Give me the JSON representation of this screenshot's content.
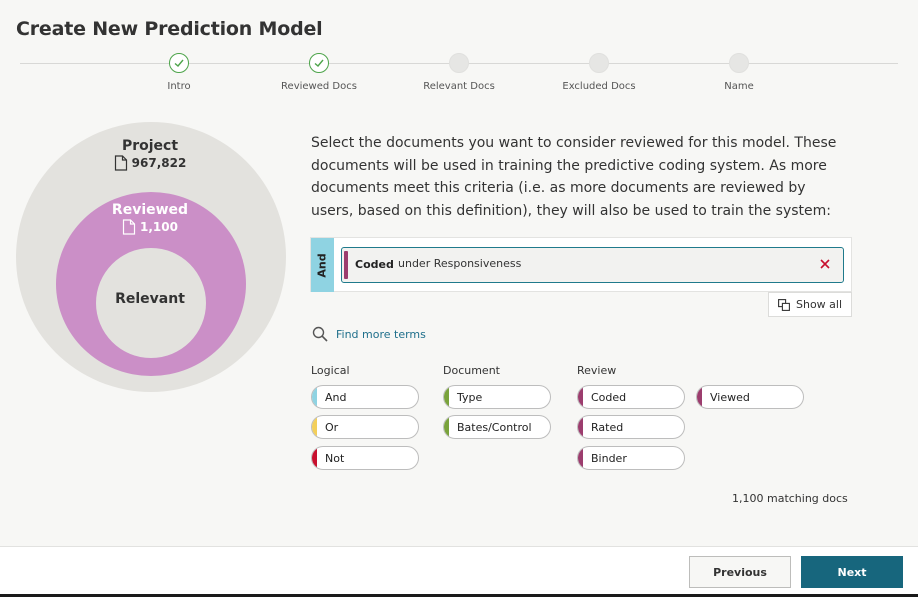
{
  "title": "Create New Prediction Model",
  "steps": [
    {
      "label": "Intro",
      "status": "done"
    },
    {
      "label": "Reviewed Docs",
      "status": "done"
    },
    {
      "label": "Relevant Docs",
      "status": "pending"
    },
    {
      "label": "Excluded Docs",
      "status": "pending"
    },
    {
      "label": "Name",
      "status": "pending"
    }
  ],
  "venn": {
    "project": {
      "label": "Project",
      "count": "967,822"
    },
    "reviewed": {
      "label": "Reviewed",
      "count": "1,100"
    },
    "relevant": {
      "label": "Relevant"
    }
  },
  "description": "Select the documents you want to consider reviewed for this model. These documents will be used in training the predictive coding system. As more documents meet this criteria (i.e. as more documents are reviewed by users, based on this definition), they will also be used to train the system:",
  "criteria": {
    "operator": "And",
    "items": [
      {
        "name": "Coded",
        "qualifier": "under Responsiveness"
      }
    ],
    "show_all_label": "Show all"
  },
  "find_more_label": "Find more terms",
  "groups": {
    "logical": {
      "label": "Logical",
      "chips": [
        {
          "label": "And",
          "color": "#8fd3e2"
        },
        {
          "label": "Or",
          "color": "#f3cf5a"
        },
        {
          "label": "Not",
          "color": "#c8102e"
        }
      ]
    },
    "document": {
      "label": "Document",
      "chips": [
        {
          "label": "Type",
          "color": "#7aa33c"
        },
        {
          "label": "Bates/Control",
          "color": "#7aa33c"
        }
      ]
    },
    "review": {
      "label": "Review",
      "chips": [
        {
          "label": "Coded",
          "color": "#9c3d6e"
        },
        {
          "label": "Rated",
          "color": "#9c3d6e"
        },
        {
          "label": "Binder",
          "color": "#9c3d6e"
        },
        {
          "label": "Viewed",
          "color": "#9c3d6e"
        }
      ]
    }
  },
  "matching_text": "1,100 matching docs",
  "footer": {
    "previous_label": "Previous",
    "next_label": "Next"
  },
  "colors": {
    "accent": "#17667d",
    "reviewed_circle": "#cb8fc7",
    "project_circle": "#e3e2de",
    "done_step": "#4da44a"
  },
  "icons": {
    "step_done": "check-icon",
    "count": "document-icon",
    "remove": "close-icon",
    "show_all": "copy-icon",
    "find": "search-icon"
  }
}
